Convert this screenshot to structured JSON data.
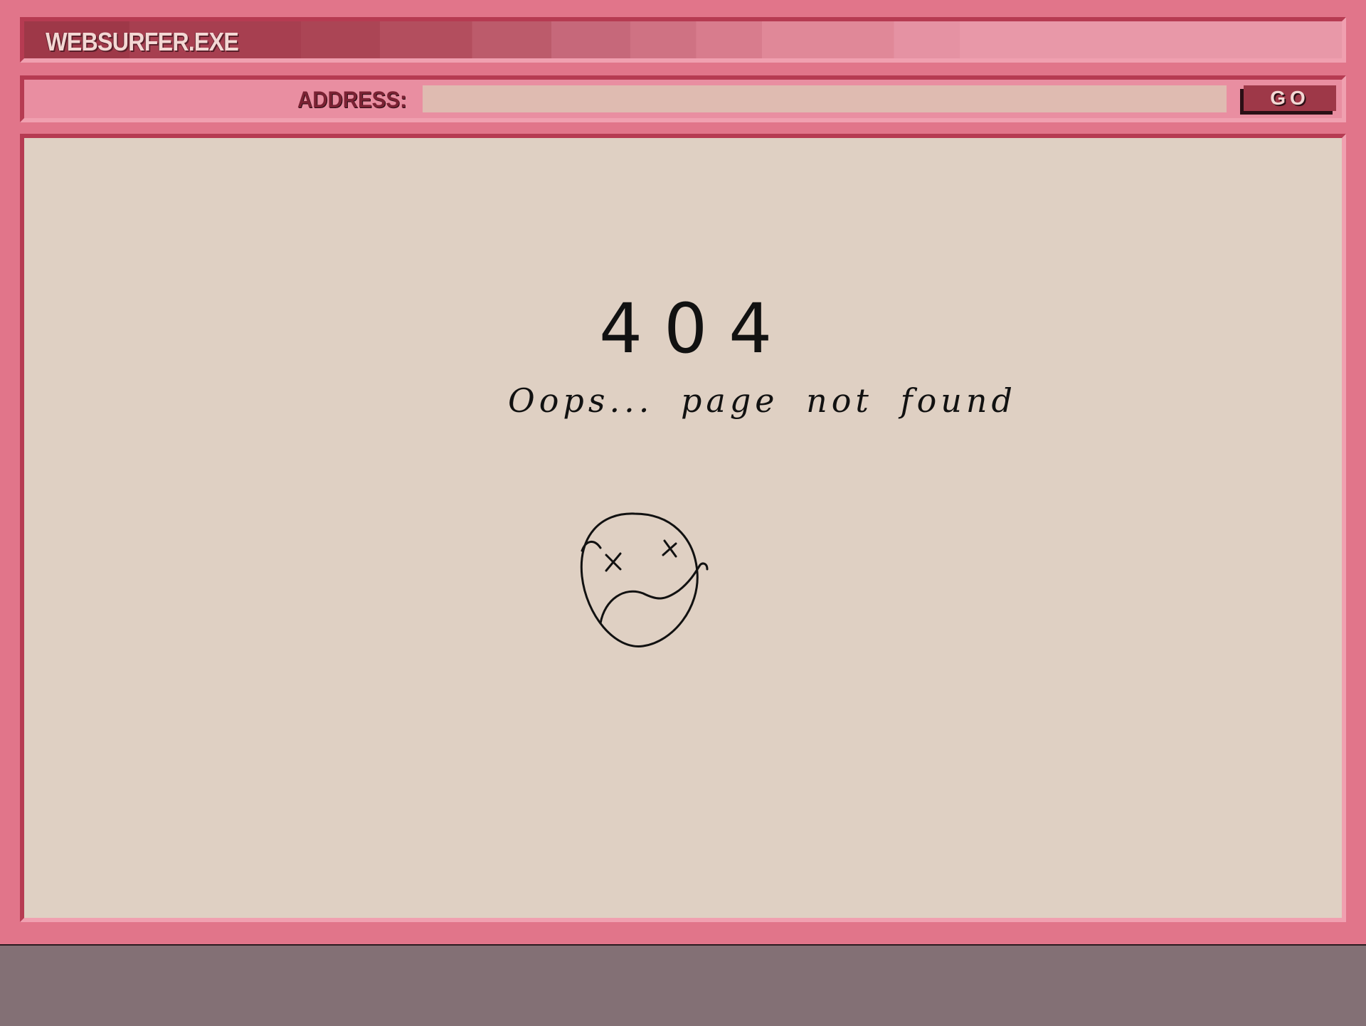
{
  "window": {
    "title": "WEBSURFER.EXE"
  },
  "address_bar": {
    "label": "ADDRESS:",
    "value": "",
    "go_label": "GO"
  },
  "page": {
    "error_code": "404",
    "message": "Oops... page not found",
    "illustration_icon": "sad-dizzy-face-icon"
  },
  "colors": {
    "frame": "#e1758a",
    "titlebar_dark": "#9e3848",
    "titlebar_light": "#e898a8",
    "address_field": "#dfbbb1",
    "content_bg": "#dfd0c3",
    "desktop": "#837075"
  }
}
